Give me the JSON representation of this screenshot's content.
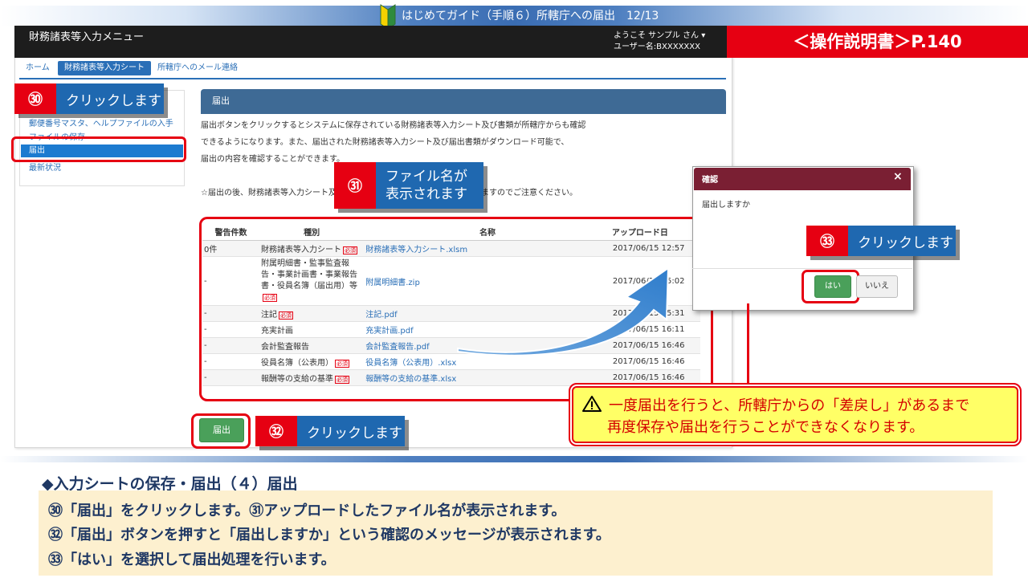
{
  "banner": {
    "title": "はじめてガイド（手順６）所轄庁への届出　12/13"
  },
  "app": {
    "title": "財務諸表等入力メニュー",
    "welcome": "ようこそ サンプル さん ▾",
    "username": "ユーザー名:BXXXXXXX"
  },
  "manual_ref": "＜操作説明書＞P.140",
  "nav": {
    "home": "ホーム",
    "sheet": "財務諸表等入力シート",
    "mail": "所轄庁へのメール連絡"
  },
  "sidebar": {
    "items": [
      "郵便番号マスタ、ヘルプファイルの入手",
      "ファイルの保存",
      "届出",
      "最新状況"
    ]
  },
  "callouts": {
    "c30": {
      "num": "㉚",
      "text": "クリックします"
    },
    "c31": {
      "num": "㉛",
      "text1": "ファイル名が",
      "text2": "表示されます"
    },
    "c32": {
      "num": "㉜",
      "text": "クリックします"
    },
    "c33": {
      "num": "㉝",
      "text": "クリックします"
    }
  },
  "panel": {
    "title": "届出",
    "desc1": "届出ボタンをクリックするとシステムに保存されている財務諸表等入力シート及び書類が所轄庁からも確認",
    "desc2": "できるようになります。また、届出された財務諸表等入力シート及び届出書類がダウンロード可能で、",
    "desc3": "届出の内容を確認することができます。",
    "desc4": "☆届出の後、財務諸表等入力シート及び届出書類の保存・届出ができなくなりますのでご注意ください。"
  },
  "table": {
    "headers": [
      "警告件数",
      "種別",
      "名称",
      "アップロード日"
    ],
    "required": "必須",
    "rows": [
      {
        "warn": "0件",
        "type": "財務諸表等入力シート",
        "req": true,
        "name": "財務諸表等入力シート.xlsm",
        "date": "2017/06/15 12:57"
      },
      {
        "warn": "-",
        "type": "附属明細書・監事監査報告・事業計画書・事業報告書・役員名簿（届出用）等",
        "req": true,
        "name": "附属明細書.zip",
        "date": "2017/06/15 15:02"
      },
      {
        "warn": "-",
        "type": "注記",
        "req": true,
        "name": "注記.pdf",
        "date": "2017/06/15 15:31"
      },
      {
        "warn": "-",
        "type": "充実計画",
        "req": false,
        "name": "充実計画.pdf",
        "date": "2017/06/15 16:11"
      },
      {
        "warn": "-",
        "type": "会計監査報告",
        "req": false,
        "name": "会計監査報告.pdf",
        "date": "2017/06/15 16:46"
      },
      {
        "warn": "-",
        "type": "役員名簿（公表用）",
        "req": true,
        "name": "役員名簿（公表用）.xlsx",
        "date": "2017/06/15 16:46"
      },
      {
        "warn": "-",
        "type": "報酬等の支給の基準",
        "req": true,
        "name": "報酬等の支給の基準.xlsx",
        "date": "2017/06/15 16:46"
      }
    ]
  },
  "submit_label": "届出",
  "dialog": {
    "title": "確認",
    "close": "×",
    "message": "届出しますか",
    "yes": "はい",
    "no": "いいえ"
  },
  "warning": {
    "line1": "一度届出を行うと、所轄庁からの「差戻し」があるまで",
    "line2": "再度保存や届出を行うことができなくなります。"
  },
  "section_title": "◆入力シートの保存・届出（４）届出",
  "notes": [
    "㉚「届出」をクリックします。㉛アップロードしたファイル名が表示されます。",
    "㉜「届出」ボタンを押すと「届出しますか」という確認のメッセージが表示されます。",
    "㉝「はい」を選択して届出処理を行います。"
  ],
  "colors": {
    "red": "#e60012",
    "blue": "#1f68b0",
    "green": "#4aa05a",
    "dialog_head": "#7a1f33",
    "panel_head": "#3e6a95"
  }
}
